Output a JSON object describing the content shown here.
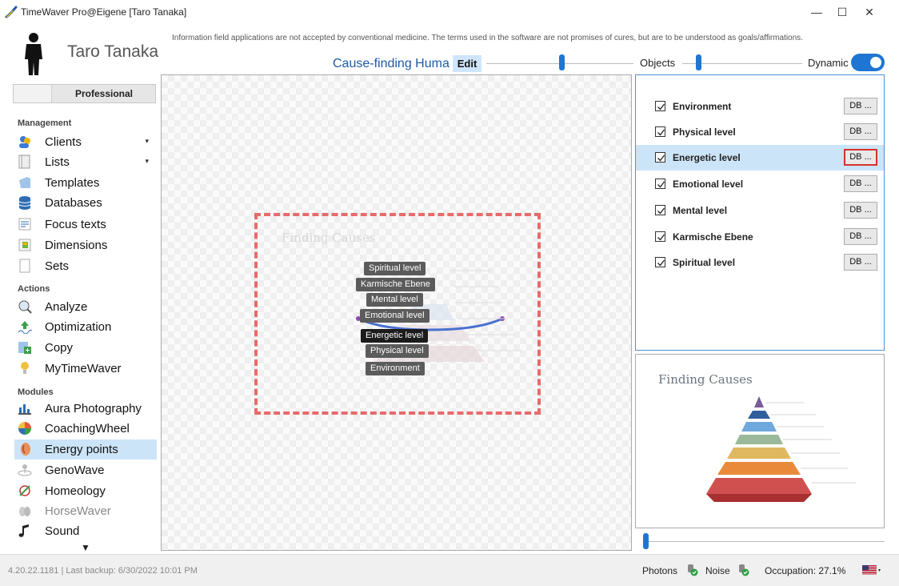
{
  "window": {
    "title": "TimeWaver Pro@Eigene [Taro Tanaka]",
    "minimize": "—",
    "maximize": "☐",
    "close": "✕"
  },
  "user": {
    "name": "Taro Tanaka",
    "profile": "Professional"
  },
  "header": {
    "disclaimer": "Information field applications are not accepted by conventional medicine. The terms used in the software are not promises of cures, but are to be understood as goals/affirmations.",
    "mode_title": "Cause-finding Huma",
    "edit_label": "Edit",
    "objects_label": "Objects",
    "dynamic_label": "Dynamic",
    "dynamic_on": true
  },
  "sidebar": {
    "sections": [
      {
        "title": "Management",
        "items": [
          {
            "label": "Clients",
            "icon": "clients-icon",
            "caret": "▾"
          },
          {
            "label": "Lists",
            "icon": "lists-icon",
            "caret": "▾"
          },
          {
            "label": "Templates",
            "icon": "templates-icon"
          },
          {
            "label": "Databases",
            "icon": "databases-icon"
          },
          {
            "label": "Focus texts",
            "icon": "focus-texts-icon"
          },
          {
            "label": "Dimensions",
            "icon": "dimensions-icon"
          },
          {
            "label": "Sets",
            "icon": "sets-icon"
          }
        ]
      },
      {
        "title": "Actions",
        "items": [
          {
            "label": "Analyze",
            "icon": "analyze-icon"
          },
          {
            "label": "Optimization",
            "icon": "optimization-icon"
          },
          {
            "label": "Copy",
            "icon": "copy-icon"
          },
          {
            "label": "MyTimeWaver",
            "icon": "mytimewaver-icon"
          }
        ]
      },
      {
        "title": "Modules",
        "items": [
          {
            "label": "Aura Photography",
            "icon": "aura-photography-icon"
          },
          {
            "label": "CoachingWheel",
            "icon": "coaching-wheel-icon"
          },
          {
            "label": "Energy points",
            "icon": "energy-points-icon",
            "active": true
          },
          {
            "label": "GenoWave",
            "icon": "genowave-icon"
          },
          {
            "label": "Homeology",
            "icon": "homeology-icon"
          },
          {
            "label": "HorseWaver",
            "icon": "horsewaver-icon",
            "disabled": true
          },
          {
            "label": "Sound",
            "icon": "sound-icon"
          }
        ]
      }
    ],
    "scroll_down": "▼"
  },
  "canvas": {
    "title": "Finding Causes",
    "pyramid_labels": [
      "Spiritual level",
      "Karmische Ebene",
      "Mental level",
      "Emotional level",
      "Energetic level",
      "Physical level",
      "Environment"
    ],
    "selected_label": "Energetic level"
  },
  "levels_list": {
    "db_label": "DB ...",
    "rows": [
      {
        "label": "Environment",
        "checked": true
      },
      {
        "label": "Physical level",
        "checked": true
      },
      {
        "label": "Energetic level",
        "checked": true,
        "selected": true
      },
      {
        "label": "Emotional level",
        "checked": true
      },
      {
        "label": "Mental level",
        "checked": true
      },
      {
        "label": "Karmische Ebene",
        "checked": true
      },
      {
        "label": "Spiritual level",
        "checked": true
      }
    ]
  },
  "preview": {
    "title": "Finding Causes"
  },
  "status": {
    "version": "4.20.22.1181 | Last backup: 6/30/2022 10:01 PM",
    "photons": "Photons",
    "noise": "Noise",
    "occupation": "Occupation: 27.1%"
  },
  "colors": {
    "accent": "#1f76d2",
    "selection": "#cce4f7",
    "drop_frame": "#e86a6a",
    "focus_border": "#d9302c"
  }
}
